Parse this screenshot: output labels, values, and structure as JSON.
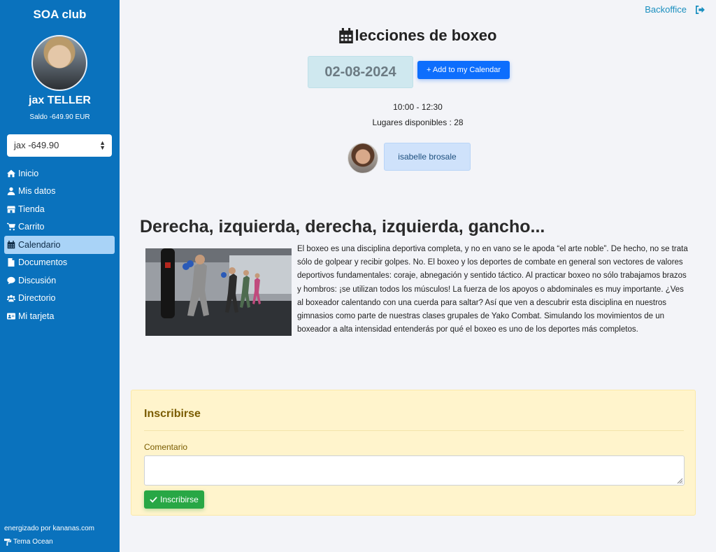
{
  "sidebar": {
    "club_name": "SOA club",
    "user_name": "jax TELLER",
    "balance": "Saldo  -649.90 EUR",
    "account_select": "jax -649.90",
    "nav": [
      {
        "label": "Inicio",
        "icon": "home-icon"
      },
      {
        "label": "Mis datos",
        "icon": "user-icon"
      },
      {
        "label": "Tienda",
        "icon": "store-icon"
      },
      {
        "label": "Carrito",
        "icon": "cart-icon"
      },
      {
        "label": "Calendario",
        "icon": "calendar-icon",
        "active": true
      },
      {
        "label": "Documentos",
        "icon": "file-icon"
      },
      {
        "label": "Discusión",
        "icon": "comment-icon"
      },
      {
        "label": "Directorio",
        "icon": "users-icon"
      },
      {
        "label": "Mi tarjeta",
        "icon": "id-card-icon"
      }
    ],
    "footer_powered": "energizado por kananas.com",
    "footer_theme": "Tema Ocean"
  },
  "header": {
    "backoffice": "Backoffice"
  },
  "event": {
    "title": "lecciones de boxeo",
    "date": "02-08-2024",
    "add_calendar": "+ Add to my Calendar",
    "time": "10:00 - 12:30",
    "places": "Lugares disponibles : 28",
    "coach": "isabelle brosale"
  },
  "article": {
    "headline": "Derecha, izquierda, derecha, izquierda, gancho...",
    "body": "El boxeo es una disciplina deportiva completa, y no en vano se le apoda “el arte noble”. De hecho, no se trata sólo de golpear y recibir golpes. No. El boxeo y los deportes de combate en general son vectores de valores deportivos fundamentales: coraje, abnegación y sentido táctico. Al practicar boxeo no sólo trabajamos brazos y hombros: ¡se utilizan todos los músculos! La fuerza de los apoyos o abdominales es muy importante. ¿Ves al boxeador calentando con una cuerda para saltar? Así que ven a descubrir esta disciplina en nuestros gimnasios como parte de nuestras clases grupales de Yako Combat. Simulando los movimientos de un boxeador a alta intensidad entenderás por qué el boxeo es uno de los deportes más completos."
  },
  "form": {
    "title": "Inscribirse",
    "comment_label": "Comentario",
    "comment_value": "",
    "submit": "Inscribirse"
  },
  "colors": {
    "sidebar": "#0a72bd",
    "primary": "#0d6efd",
    "success": "#28a745",
    "warning_bg": "#fff4cc"
  }
}
